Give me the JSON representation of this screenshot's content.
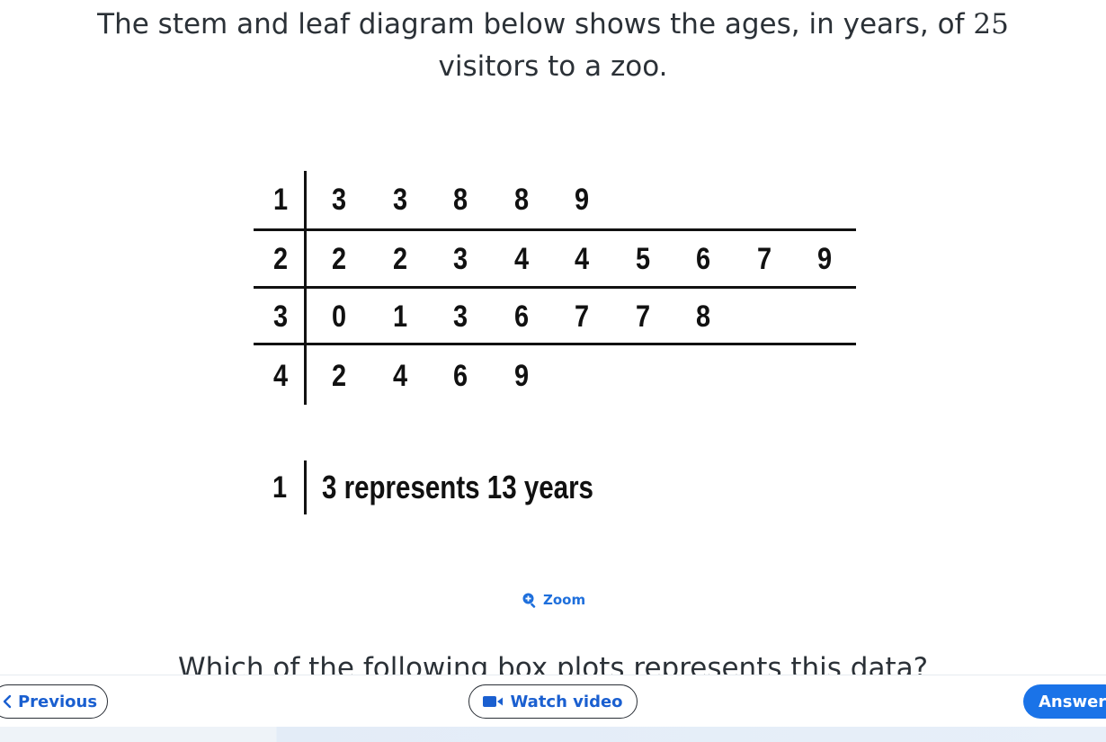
{
  "question": {
    "text_before": "The stem and leaf diagram below shows the ages, in years, of ",
    "count": "25",
    "text_after": "visitors to a zoo."
  },
  "diagram": {
    "rows": [
      {
        "stem": "1",
        "leaves": [
          "3",
          "3",
          "8",
          "8",
          "9"
        ]
      },
      {
        "stem": "2",
        "leaves": [
          "2",
          "2",
          "3",
          "4",
          "4",
          "5",
          "6",
          "7",
          "9"
        ]
      },
      {
        "stem": "3",
        "leaves": [
          "0",
          "1",
          "3",
          "6",
          "7",
          "7",
          "8"
        ]
      },
      {
        "stem": "4",
        "leaves": [
          "2",
          "4",
          "6",
          "9"
        ]
      }
    ],
    "key": {
      "stem": "1",
      "text": "3  represents 13 years"
    }
  },
  "zoom": {
    "label": "Zoom",
    "icon": "zoom-in-icon"
  },
  "question2": {
    "text": "Which of the following box plots represents this data?"
  },
  "footer": {
    "previous_label": "Previous",
    "video_label": "Watch video",
    "answer_label": "Answer"
  },
  "colors": {
    "accent": "#1a73e8",
    "link": "#1e6fdc"
  }
}
